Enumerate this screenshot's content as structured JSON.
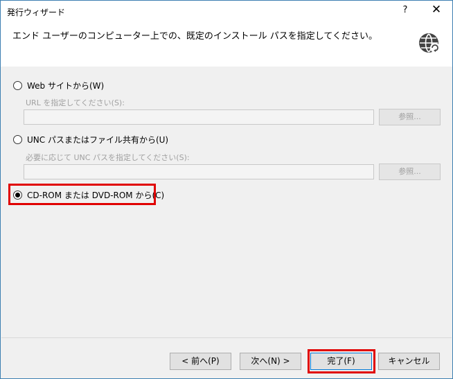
{
  "window": {
    "title": "発行ウィザード"
  },
  "titlebar": {
    "help_label": "?",
    "close_label": "✕"
  },
  "header": {
    "text": "エンド ユーザーのコンピューター上での、既定のインストール パスを指定してください。"
  },
  "options": [
    {
      "label": "Web サイトから(W)",
      "checked": false,
      "sub_label": "URL を指定してください(S):",
      "field_value": "",
      "browse_label": "参照..."
    },
    {
      "label": "UNC パスまたはファイル共有から(U)",
      "checked": false,
      "sub_label": "必要に応じて UNC パスを指定してください(S):",
      "field_value": "",
      "browse_label": "参照..."
    },
    {
      "label": "CD-ROM または DVD-ROM から(C)",
      "checked": true
    }
  ],
  "footer": {
    "back_label": "< 前へ(P)",
    "next_label": "次へ(N) >",
    "finish_label": "完了(F)",
    "cancel_label": "キャンセル"
  },
  "colors": {
    "highlight": "#e00000",
    "accent": "#0078d7"
  }
}
